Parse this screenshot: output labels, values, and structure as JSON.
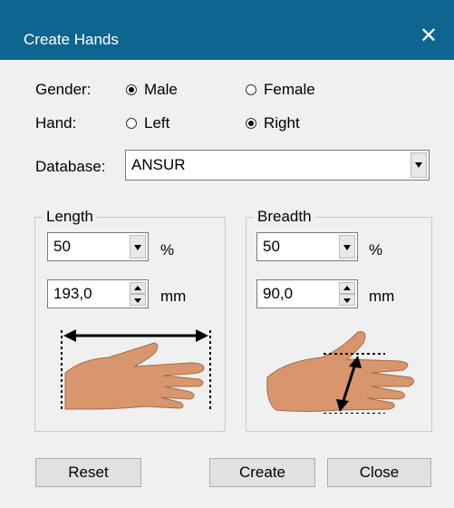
{
  "dialog": {
    "title": "Create Hands",
    "close_icon": "close-icon"
  },
  "gender": {
    "label": "Gender:",
    "options": [
      {
        "label": "Male",
        "checked": true
      },
      {
        "label": "Female",
        "checked": false
      }
    ]
  },
  "hand": {
    "label": "Hand:",
    "options": [
      {
        "label": "Left",
        "checked": false
      },
      {
        "label": "Right",
        "checked": true
      }
    ]
  },
  "database": {
    "label": "Database:",
    "value": "ANSUR"
  },
  "length": {
    "title": "Length",
    "percentile": "50",
    "percent_unit": "%",
    "value": "193,0",
    "value_unit": "mm",
    "illustration": "hand-length-icon"
  },
  "breadth": {
    "title": "Breadth",
    "percentile": "50",
    "percent_unit": "%",
    "value": "90,0",
    "value_unit": "mm",
    "illustration": "hand-breadth-icon"
  },
  "buttons": {
    "reset": "Reset",
    "create": "Create",
    "close": "Close"
  },
  "colors": {
    "titlebar": "#0e6590",
    "skin": "#d8966e"
  }
}
